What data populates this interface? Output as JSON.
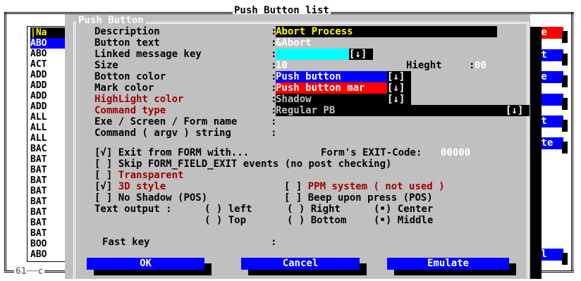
{
  "list_window": {
    "title": "Push Button list",
    "count_label": "61",
    "count_suffix": "c",
    "items": [
      "|Na",
      "ABO",
      "ABO",
      "ABO",
      "ACT",
      "ADD",
      "ADD",
      "ADD",
      "ADD",
      "ALL",
      "ALL",
      "ALL",
      "BAC",
      "BAT",
      "BAT",
      "BAT",
      "BAT",
      "BAT",
      "BAT",
      "BAT",
      "BAT",
      "BOO"
    ],
    "right_buttons": [
      "te",
      "rt",
      "te",
      "y",
      "rt",
      "ate",
      "el"
    ]
  },
  "dialog": {
    "title": "Push Button",
    "fields": {
      "description_label": "Description",
      "description_value": "Abort Process",
      "button_text_label": "Button text",
      "button_text_value": "&Abort",
      "linked_key_label": "Linked message key",
      "linked_key_value": "",
      "size_label": "Size",
      "size_value": "10",
      "height_label": "Hieght",
      "height_value": "00",
      "button_color_label": "Botton color",
      "button_color_value": "Push button",
      "mark_color_label": "Mark color",
      "mark_color_value": "Push button mar",
      "highlight_color_label": "HighLight color",
      "highlight_color_value": "Shadow",
      "command_type_label": "Command type",
      "command_type_value": "Regular PB",
      "exe_label": "Exe / Screen / Form name",
      "exe_value": "",
      "command_label": "Command ( argv ) string",
      "command_value": ""
    },
    "dropdown_glyph": "[↓]",
    "colon": ":",
    "options": {
      "exit_form": {
        "mark": "[√]",
        "label": "Exit from FORM with..."
      },
      "exit_code_label": "Form's EXIT-Code:",
      "exit_code_value": "00000",
      "skip_event": {
        "mark": "[ ]",
        "label": "Skip FORM_FIELD_EXIT events (no post checking)"
      },
      "transparent": {
        "mark": "[ ]",
        "label": "Transparent"
      },
      "style_3d": {
        "mark": "[√]",
        "label": "3D style"
      },
      "ppm_system": {
        "mark": "[ ]",
        "label": "PPM system ( not used )"
      },
      "no_shadow": {
        "mark": "[ ]",
        "label": "No Shadow (POS)"
      },
      "beep": {
        "mark": "[ ]",
        "label": "Beep upon press (POS)"
      }
    },
    "text_output": {
      "label": "Text output :",
      "left": "( ) left",
      "top": "( ) Top",
      "right": "( ) Right",
      "bottom": "( ) Bottom",
      "center": "(•) Center",
      "middle": "(•) Middle"
    },
    "fast_key_label": "Fast key",
    "fast_key_value": "",
    "buttons": {
      "ok": "OK",
      "cancel": "Cancel",
      "emulate": "Emulate"
    }
  },
  "colors": {
    "dialog_bg": "#c0c0c0",
    "button_blue": "#0000ff",
    "field_yellow": "#ffff00",
    "field_cyan": "#00ffff",
    "red_field": "#ff0000",
    "dark_red_label": "#a00000"
  }
}
